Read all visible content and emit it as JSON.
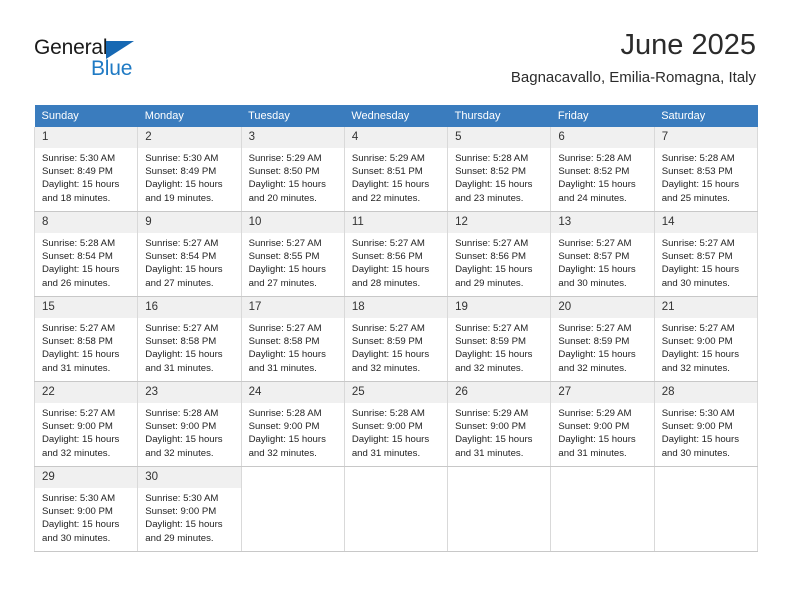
{
  "branding": {
    "logo_text_top": "General",
    "logo_text_bottom": "Blue",
    "logo_accent_color": "#1668b3"
  },
  "header": {
    "month_title": "June 2025",
    "location": "Bagnacavallo, Emilia-Romagna, Italy"
  },
  "calendar": {
    "header_background": "#3a7cbe",
    "weekday_headers": [
      "Sunday",
      "Monday",
      "Tuesday",
      "Wednesday",
      "Thursday",
      "Friday",
      "Saturday"
    ],
    "weeks": [
      [
        {
          "day": "1",
          "sunrise": "Sunrise: 5:30 AM",
          "sunset": "Sunset: 8:49 PM",
          "daylight": "Daylight: 15 hours and 18 minutes."
        },
        {
          "day": "2",
          "sunrise": "Sunrise: 5:30 AM",
          "sunset": "Sunset: 8:49 PM",
          "daylight": "Daylight: 15 hours and 19 minutes."
        },
        {
          "day": "3",
          "sunrise": "Sunrise: 5:29 AM",
          "sunset": "Sunset: 8:50 PM",
          "daylight": "Daylight: 15 hours and 20 minutes."
        },
        {
          "day": "4",
          "sunrise": "Sunrise: 5:29 AM",
          "sunset": "Sunset: 8:51 PM",
          "daylight": "Daylight: 15 hours and 22 minutes."
        },
        {
          "day": "5",
          "sunrise": "Sunrise: 5:28 AM",
          "sunset": "Sunset: 8:52 PM",
          "daylight": "Daylight: 15 hours and 23 minutes."
        },
        {
          "day": "6",
          "sunrise": "Sunrise: 5:28 AM",
          "sunset": "Sunset: 8:52 PM",
          "daylight": "Daylight: 15 hours and 24 minutes."
        },
        {
          "day": "7",
          "sunrise": "Sunrise: 5:28 AM",
          "sunset": "Sunset: 8:53 PM",
          "daylight": "Daylight: 15 hours and 25 minutes."
        }
      ],
      [
        {
          "day": "8",
          "sunrise": "Sunrise: 5:28 AM",
          "sunset": "Sunset: 8:54 PM",
          "daylight": "Daylight: 15 hours and 26 minutes."
        },
        {
          "day": "9",
          "sunrise": "Sunrise: 5:27 AM",
          "sunset": "Sunset: 8:54 PM",
          "daylight": "Daylight: 15 hours and 27 minutes."
        },
        {
          "day": "10",
          "sunrise": "Sunrise: 5:27 AM",
          "sunset": "Sunset: 8:55 PM",
          "daylight": "Daylight: 15 hours and 27 minutes."
        },
        {
          "day": "11",
          "sunrise": "Sunrise: 5:27 AM",
          "sunset": "Sunset: 8:56 PM",
          "daylight": "Daylight: 15 hours and 28 minutes."
        },
        {
          "day": "12",
          "sunrise": "Sunrise: 5:27 AM",
          "sunset": "Sunset: 8:56 PM",
          "daylight": "Daylight: 15 hours and 29 minutes."
        },
        {
          "day": "13",
          "sunrise": "Sunrise: 5:27 AM",
          "sunset": "Sunset: 8:57 PM",
          "daylight": "Daylight: 15 hours and 30 minutes."
        },
        {
          "day": "14",
          "sunrise": "Sunrise: 5:27 AM",
          "sunset": "Sunset: 8:57 PM",
          "daylight": "Daylight: 15 hours and 30 minutes."
        }
      ],
      [
        {
          "day": "15",
          "sunrise": "Sunrise: 5:27 AM",
          "sunset": "Sunset: 8:58 PM",
          "daylight": "Daylight: 15 hours and 31 minutes."
        },
        {
          "day": "16",
          "sunrise": "Sunrise: 5:27 AM",
          "sunset": "Sunset: 8:58 PM",
          "daylight": "Daylight: 15 hours and 31 minutes."
        },
        {
          "day": "17",
          "sunrise": "Sunrise: 5:27 AM",
          "sunset": "Sunset: 8:58 PM",
          "daylight": "Daylight: 15 hours and 31 minutes."
        },
        {
          "day": "18",
          "sunrise": "Sunrise: 5:27 AM",
          "sunset": "Sunset: 8:59 PM",
          "daylight": "Daylight: 15 hours and 32 minutes."
        },
        {
          "day": "19",
          "sunrise": "Sunrise: 5:27 AM",
          "sunset": "Sunset: 8:59 PM",
          "daylight": "Daylight: 15 hours and 32 minutes."
        },
        {
          "day": "20",
          "sunrise": "Sunrise: 5:27 AM",
          "sunset": "Sunset: 8:59 PM",
          "daylight": "Daylight: 15 hours and 32 minutes."
        },
        {
          "day": "21",
          "sunrise": "Sunrise: 5:27 AM",
          "sunset": "Sunset: 9:00 PM",
          "daylight": "Daylight: 15 hours and 32 minutes."
        }
      ],
      [
        {
          "day": "22",
          "sunrise": "Sunrise: 5:27 AM",
          "sunset": "Sunset: 9:00 PM",
          "daylight": "Daylight: 15 hours and 32 minutes."
        },
        {
          "day": "23",
          "sunrise": "Sunrise: 5:28 AM",
          "sunset": "Sunset: 9:00 PM",
          "daylight": "Daylight: 15 hours and 32 minutes."
        },
        {
          "day": "24",
          "sunrise": "Sunrise: 5:28 AM",
          "sunset": "Sunset: 9:00 PM",
          "daylight": "Daylight: 15 hours and 32 minutes."
        },
        {
          "day": "25",
          "sunrise": "Sunrise: 5:28 AM",
          "sunset": "Sunset: 9:00 PM",
          "daylight": "Daylight: 15 hours and 31 minutes."
        },
        {
          "day": "26",
          "sunrise": "Sunrise: 5:29 AM",
          "sunset": "Sunset: 9:00 PM",
          "daylight": "Daylight: 15 hours and 31 minutes."
        },
        {
          "day": "27",
          "sunrise": "Sunrise: 5:29 AM",
          "sunset": "Sunset: 9:00 PM",
          "daylight": "Daylight: 15 hours and 31 minutes."
        },
        {
          "day": "28",
          "sunrise": "Sunrise: 5:30 AM",
          "sunset": "Sunset: 9:00 PM",
          "daylight": "Daylight: 15 hours and 30 minutes."
        }
      ],
      [
        {
          "day": "29",
          "sunrise": "Sunrise: 5:30 AM",
          "sunset": "Sunset: 9:00 PM",
          "daylight": "Daylight: 15 hours and 30 minutes."
        },
        {
          "day": "30",
          "sunrise": "Sunrise: 5:30 AM",
          "sunset": "Sunset: 9:00 PM",
          "daylight": "Daylight: 15 hours and 29 minutes."
        },
        {
          "day": "",
          "sunrise": "",
          "sunset": "",
          "daylight": ""
        },
        {
          "day": "",
          "sunrise": "",
          "sunset": "",
          "daylight": ""
        },
        {
          "day": "",
          "sunrise": "",
          "sunset": "",
          "daylight": ""
        },
        {
          "day": "",
          "sunrise": "",
          "sunset": "",
          "daylight": ""
        },
        {
          "day": "",
          "sunrise": "",
          "sunset": "",
          "daylight": ""
        }
      ]
    ]
  }
}
